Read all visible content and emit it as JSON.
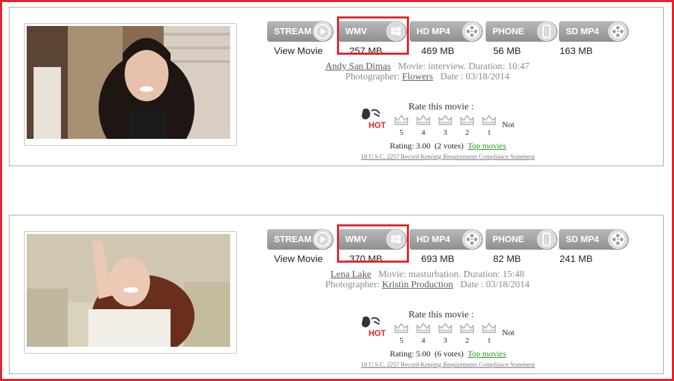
{
  "colors": {
    "highlight": "#e8202a",
    "button": "#9e9e9e",
    "link_green": "#1a9a1a"
  },
  "formats": [
    {
      "label": "STREAM",
      "icon": "play-icon"
    },
    {
      "label": "WMV",
      "icon": "windows-icon"
    },
    {
      "label": "HD MP4",
      "icon": "film-reel-icon"
    },
    {
      "label": "PHONE",
      "icon": "phone-icon"
    },
    {
      "label": "SD MP4",
      "icon": "film-reel-icon"
    }
  ],
  "rating_ui": {
    "title": "Rate this movie :",
    "star_labels": [
      "5",
      "4",
      "3",
      "2",
      "1"
    ],
    "not_label": "Not",
    "hot_label": "HOT",
    "top_movies_label": "Top movies",
    "legal_text": "18 U.S.C. 2257 Record-Keeping Requirements Compliance Statement"
  },
  "movies": [
    {
      "model": "Andy San Dimas",
      "movie_prefix": "Movie:",
      "movie": "interview.",
      "duration_prefix": "Duration:",
      "duration": "10:47",
      "photographer_prefix": "Photographer:",
      "photographer": "Flowers",
      "date_prefix": "Date :",
      "date": "03/18/2014",
      "sizes": [
        "View Movie",
        "257 MB",
        "469 MB",
        "56 MB",
        "163 MB"
      ],
      "rating_text": "Rating: 3.00",
      "votes_text": "(2 votes)"
    },
    {
      "model": "Lena Lake",
      "movie_prefix": "Movie:",
      "movie": "masturbation.",
      "duration_prefix": "Duration:",
      "duration": "15:48",
      "photographer_prefix": "Photographer:",
      "photographer": "Kristin Production",
      "date_prefix": "Date :",
      "date": "03/18/2014",
      "sizes": [
        "View Movie",
        "370 MB",
        "693 MB",
        "82 MB",
        "241 MB"
      ],
      "rating_text": "Rating: 5.00",
      "votes_text": "(6 votes)"
    }
  ]
}
